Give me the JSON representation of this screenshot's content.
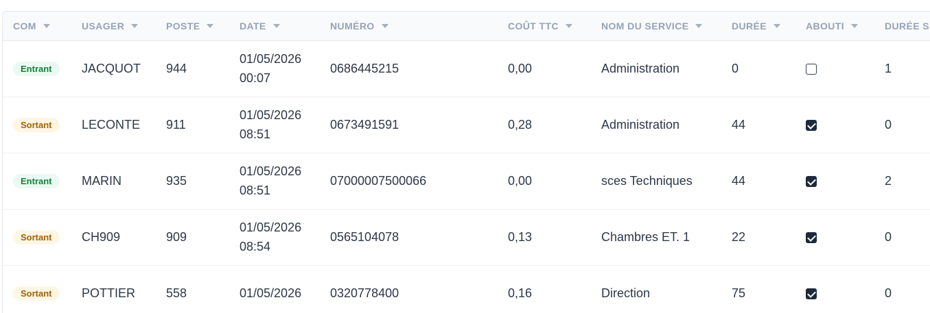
{
  "columns": [
    {
      "label": "COM",
      "icon": "caret-down-icon"
    },
    {
      "label": "USAGER",
      "icon": "caret-down-icon"
    },
    {
      "label": "POSTE",
      "icon": "caret-down-icon"
    },
    {
      "label": "DATE",
      "icon": "caret-down-icon"
    },
    {
      "label": "NUMÉRO",
      "icon": "caret-down-icon"
    },
    {
      "label": "COÛT TTC",
      "icon": "caret-down-icon"
    },
    {
      "label": "NOM DU SERVICE",
      "icon": "caret-down-icon"
    },
    {
      "label": "DURÉE",
      "icon": "caret-down-icon"
    },
    {
      "label": "ABOUTI",
      "icon": "caret-down-icon"
    },
    {
      "label": "DURÉE S",
      "icon": ""
    }
  ],
  "rows": [
    {
      "com": "Entrant",
      "com_type": "in",
      "usager": "JACQUOT",
      "poste": "944",
      "date": "01/05/2026",
      "time": "00:07",
      "numero": "0686445215",
      "cout": "0,00",
      "service": "Administration",
      "duree": "0",
      "abouti": false,
      "duree_s": "1"
    },
    {
      "com": "Sortant",
      "com_type": "out",
      "usager": "LECONTE",
      "poste": "911",
      "date": "01/05/2026",
      "time": "08:51",
      "numero": "0673491591",
      "cout": "0,28",
      "service": "Administration",
      "duree": "44",
      "abouti": true,
      "duree_s": "0"
    },
    {
      "com": "Entrant",
      "com_type": "in",
      "usager": "MARIN",
      "poste": "935",
      "date": "01/05/2026",
      "time": "08:51",
      "numero": "07000007500066",
      "cout": "0,00",
      "service": "sces Techniques",
      "duree": "44",
      "abouti": true,
      "duree_s": "2"
    },
    {
      "com": "Sortant",
      "com_type": "out",
      "usager": "CH909",
      "poste": "909",
      "date": "01/05/2026",
      "time": "08:54",
      "numero": "0565104078",
      "cout": "0,13",
      "service": "Chambres ET. 1",
      "duree": "22",
      "abouti": true,
      "duree_s": "0"
    },
    {
      "com": "Sortant",
      "com_type": "out",
      "usager": "POTTIER",
      "poste": "558",
      "date": "01/05/2026",
      "time": "",
      "numero": "0320778400",
      "cout": "0,16",
      "service": "Direction",
      "duree": "75",
      "abouti": true,
      "duree_s": "0"
    }
  ],
  "colors": {
    "header_bg": "#f9fafb",
    "header_text": "#94a3b8",
    "badge_in_bg": "#eafaf2",
    "badge_in_text": "#15803d",
    "badge_out_bg": "#fdf6e3",
    "badge_out_text": "#a16207",
    "checkbox_on": "#1e293b"
  }
}
